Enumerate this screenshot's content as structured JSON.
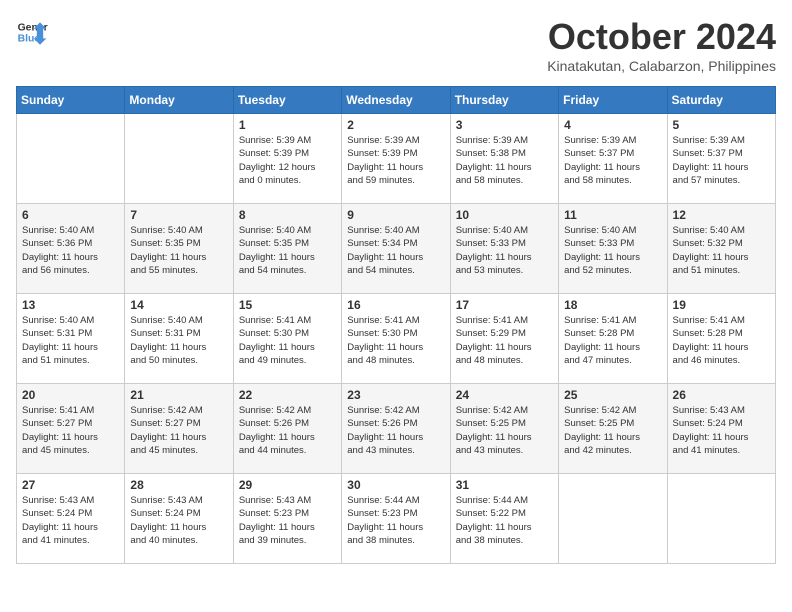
{
  "header": {
    "logo_line1": "General",
    "logo_line2": "Blue",
    "month": "October 2024",
    "location": "Kinatakutan, Calabarzon, Philippines"
  },
  "days_of_week": [
    "Sunday",
    "Monday",
    "Tuesday",
    "Wednesday",
    "Thursday",
    "Friday",
    "Saturday"
  ],
  "weeks": [
    [
      {
        "day": "",
        "info": ""
      },
      {
        "day": "",
        "info": ""
      },
      {
        "day": "1",
        "info": "Sunrise: 5:39 AM\nSunset: 5:39 PM\nDaylight: 12 hours\nand 0 minutes."
      },
      {
        "day": "2",
        "info": "Sunrise: 5:39 AM\nSunset: 5:39 PM\nDaylight: 11 hours\nand 59 minutes."
      },
      {
        "day": "3",
        "info": "Sunrise: 5:39 AM\nSunset: 5:38 PM\nDaylight: 11 hours\nand 58 minutes."
      },
      {
        "day": "4",
        "info": "Sunrise: 5:39 AM\nSunset: 5:37 PM\nDaylight: 11 hours\nand 58 minutes."
      },
      {
        "day": "5",
        "info": "Sunrise: 5:39 AM\nSunset: 5:37 PM\nDaylight: 11 hours\nand 57 minutes."
      }
    ],
    [
      {
        "day": "6",
        "info": "Sunrise: 5:40 AM\nSunset: 5:36 PM\nDaylight: 11 hours\nand 56 minutes."
      },
      {
        "day": "7",
        "info": "Sunrise: 5:40 AM\nSunset: 5:35 PM\nDaylight: 11 hours\nand 55 minutes."
      },
      {
        "day": "8",
        "info": "Sunrise: 5:40 AM\nSunset: 5:35 PM\nDaylight: 11 hours\nand 54 minutes."
      },
      {
        "day": "9",
        "info": "Sunrise: 5:40 AM\nSunset: 5:34 PM\nDaylight: 11 hours\nand 54 minutes."
      },
      {
        "day": "10",
        "info": "Sunrise: 5:40 AM\nSunset: 5:33 PM\nDaylight: 11 hours\nand 53 minutes."
      },
      {
        "day": "11",
        "info": "Sunrise: 5:40 AM\nSunset: 5:33 PM\nDaylight: 11 hours\nand 52 minutes."
      },
      {
        "day": "12",
        "info": "Sunrise: 5:40 AM\nSunset: 5:32 PM\nDaylight: 11 hours\nand 51 minutes."
      }
    ],
    [
      {
        "day": "13",
        "info": "Sunrise: 5:40 AM\nSunset: 5:31 PM\nDaylight: 11 hours\nand 51 minutes."
      },
      {
        "day": "14",
        "info": "Sunrise: 5:40 AM\nSunset: 5:31 PM\nDaylight: 11 hours\nand 50 minutes."
      },
      {
        "day": "15",
        "info": "Sunrise: 5:41 AM\nSunset: 5:30 PM\nDaylight: 11 hours\nand 49 minutes."
      },
      {
        "day": "16",
        "info": "Sunrise: 5:41 AM\nSunset: 5:30 PM\nDaylight: 11 hours\nand 48 minutes."
      },
      {
        "day": "17",
        "info": "Sunrise: 5:41 AM\nSunset: 5:29 PM\nDaylight: 11 hours\nand 48 minutes."
      },
      {
        "day": "18",
        "info": "Sunrise: 5:41 AM\nSunset: 5:28 PM\nDaylight: 11 hours\nand 47 minutes."
      },
      {
        "day": "19",
        "info": "Sunrise: 5:41 AM\nSunset: 5:28 PM\nDaylight: 11 hours\nand 46 minutes."
      }
    ],
    [
      {
        "day": "20",
        "info": "Sunrise: 5:41 AM\nSunset: 5:27 PM\nDaylight: 11 hours\nand 45 minutes."
      },
      {
        "day": "21",
        "info": "Sunrise: 5:42 AM\nSunset: 5:27 PM\nDaylight: 11 hours\nand 45 minutes."
      },
      {
        "day": "22",
        "info": "Sunrise: 5:42 AM\nSunset: 5:26 PM\nDaylight: 11 hours\nand 44 minutes."
      },
      {
        "day": "23",
        "info": "Sunrise: 5:42 AM\nSunset: 5:26 PM\nDaylight: 11 hours\nand 43 minutes."
      },
      {
        "day": "24",
        "info": "Sunrise: 5:42 AM\nSunset: 5:25 PM\nDaylight: 11 hours\nand 43 minutes."
      },
      {
        "day": "25",
        "info": "Sunrise: 5:42 AM\nSunset: 5:25 PM\nDaylight: 11 hours\nand 42 minutes."
      },
      {
        "day": "26",
        "info": "Sunrise: 5:43 AM\nSunset: 5:24 PM\nDaylight: 11 hours\nand 41 minutes."
      }
    ],
    [
      {
        "day": "27",
        "info": "Sunrise: 5:43 AM\nSunset: 5:24 PM\nDaylight: 11 hours\nand 41 minutes."
      },
      {
        "day": "28",
        "info": "Sunrise: 5:43 AM\nSunset: 5:24 PM\nDaylight: 11 hours\nand 40 minutes."
      },
      {
        "day": "29",
        "info": "Sunrise: 5:43 AM\nSunset: 5:23 PM\nDaylight: 11 hours\nand 39 minutes."
      },
      {
        "day": "30",
        "info": "Sunrise: 5:44 AM\nSunset: 5:23 PM\nDaylight: 11 hours\nand 38 minutes."
      },
      {
        "day": "31",
        "info": "Sunrise: 5:44 AM\nSunset: 5:22 PM\nDaylight: 11 hours\nand 38 minutes."
      },
      {
        "day": "",
        "info": ""
      },
      {
        "day": "",
        "info": ""
      }
    ]
  ]
}
